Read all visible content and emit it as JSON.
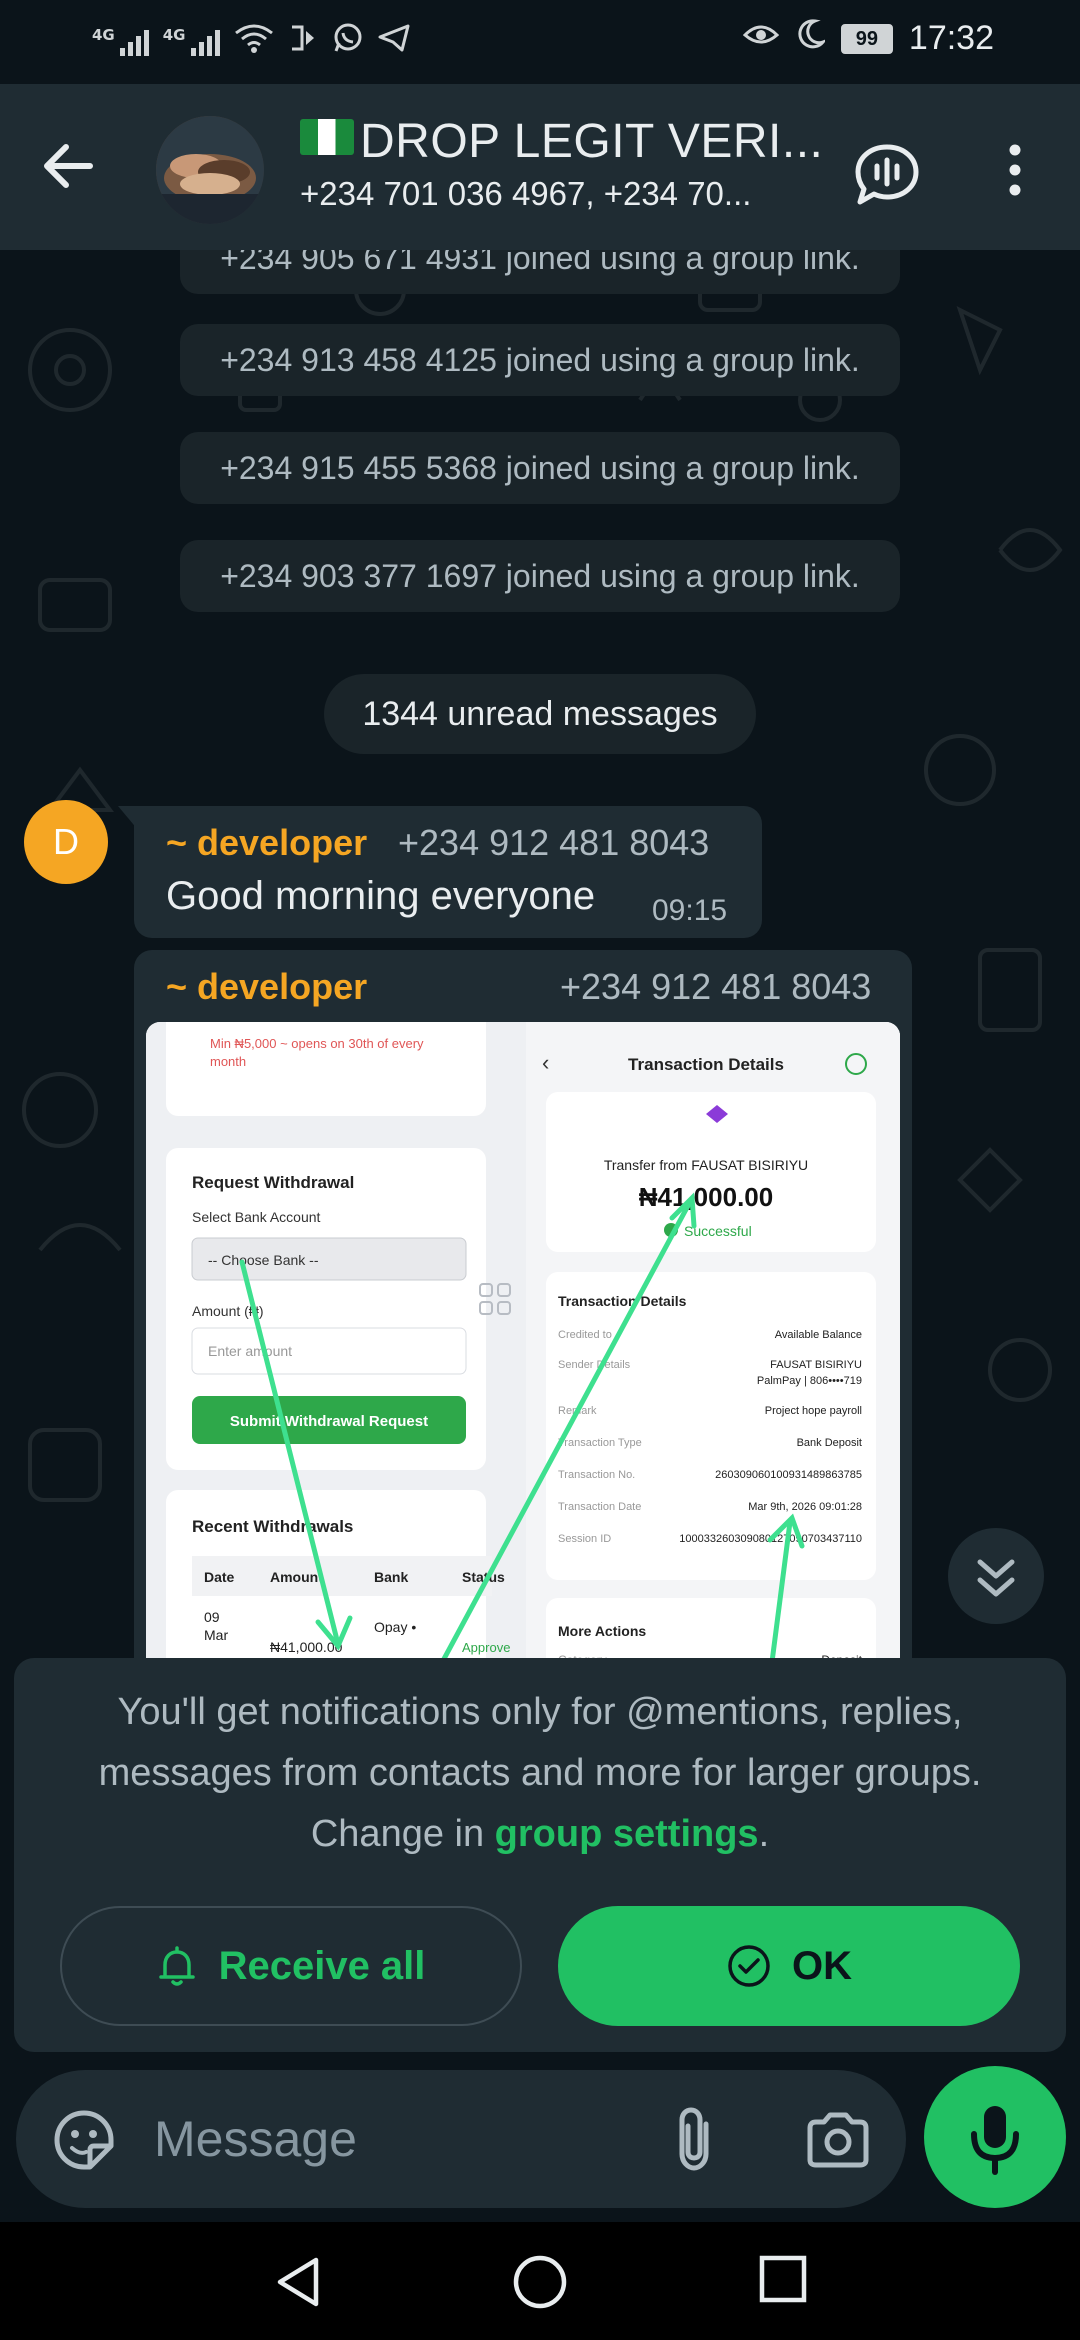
{
  "status_bar": {
    "network_1": "4G",
    "network_2": "4G",
    "battery": "99",
    "time": "17:32"
  },
  "header": {
    "group_name": "DROP LEGIT VERI...",
    "participants": "+234 701 036 4967, +234 70..."
  },
  "system_messages": [
    "+234 905 671 4931 joined using a group link.",
    "+234 913 458 4125 joined using a group link.",
    "+234 915 455 5368 joined using a group link.",
    "+234 903 377 1697 joined using a group link."
  ],
  "unread_banner": "1344 unread messages",
  "messages": [
    {
      "avatar_initial": "D",
      "sender": "~ developer",
      "phone": "+234 912 481 8043",
      "text": "Good morning everyone",
      "time": "09:15"
    },
    {
      "sender": "~ developer",
      "phone": "+234 912 481 8043"
    }
  ],
  "screenshot": {
    "min_note_1": "Min ₦5,000 ~ opens on 30th of every",
    "min_note_2": "month",
    "req_title": "Request Withdrawal",
    "select_bank_label": "Select Bank Account",
    "select_value": "-- Choose Bank --",
    "amount_label": "Amount (₦)",
    "amount_placeholder": "Enter amount",
    "submit_label": "Submit Withdrawal Request",
    "recent_title": "Recent Withdrawals",
    "table_headers": [
      "Date",
      "Amount",
      "Bank",
      "Status"
    ],
    "row_date_1": "09",
    "row_date_2": "Mar",
    "row_amount": "₦41,000.00",
    "row_bank": "Opay •",
    "row_status": "Approve",
    "td_title": "Transaction Details",
    "transfer_from": "Transfer from FAUSAT BISIRIYU",
    "amount": "₦41,000.00",
    "status": "Successful",
    "details_title": "Transaction Details",
    "rows": [
      {
        "label": "Credited to",
        "value": "Available Balance"
      },
      {
        "label": "Sender Details",
        "value": "FAUSAT BISIRIYU"
      },
      {
        "label": "",
        "value": "PalmPay | 806••••719"
      },
      {
        "label": "Remark",
        "value": "Project hope payroll"
      },
      {
        "label": "Transaction Type",
        "value": "Bank Deposit"
      },
      {
        "label": "Transaction No.",
        "value": "260309060100931489863785"
      },
      {
        "label": "Transaction Date",
        "value": "Mar 9th, 2026 09:01:28"
      },
      {
        "label": "Session ID",
        "value": "100033260309080127090703437110"
      }
    ],
    "more_actions": "More Actions",
    "category_label": "Category",
    "category_value": "Deposit"
  },
  "notice": {
    "text": "You'll get notifications only for @mentions, replies, messages from contacts and more for larger groups. Change in ",
    "link": "group settings",
    "period": ".",
    "receive_all": "Receive all",
    "ok": "OK"
  },
  "input": {
    "placeholder": "Message"
  },
  "colors": {
    "accent_green": "#21c063",
    "sender_orange": "#f5a623",
    "bubble": "#1f2c33",
    "background": "#0b141a"
  }
}
